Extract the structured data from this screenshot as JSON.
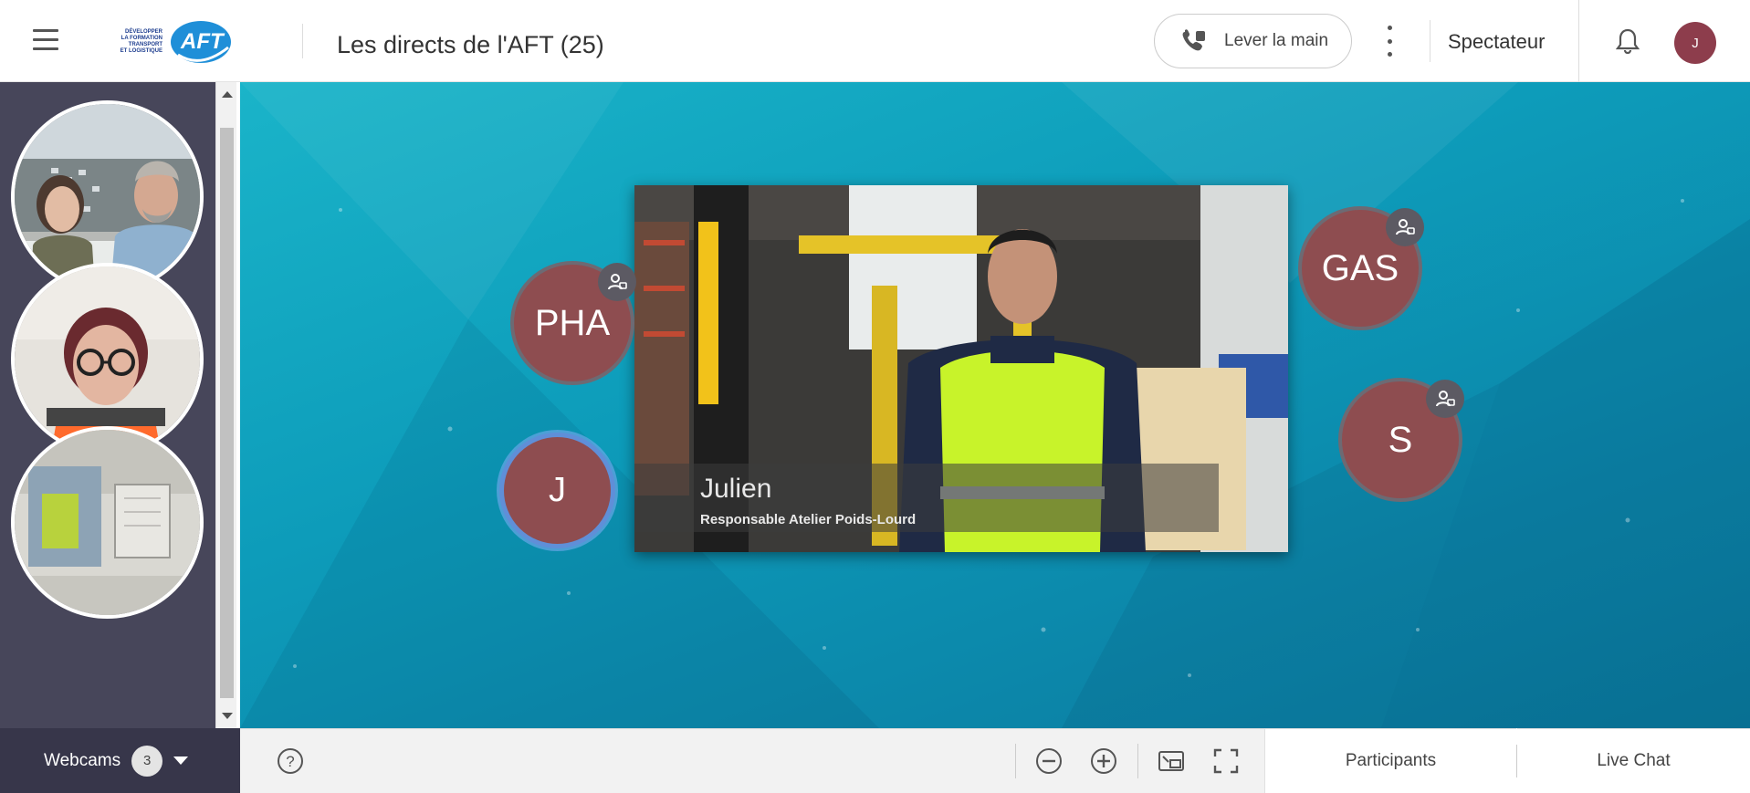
{
  "header": {
    "menu_icon": "hamburger-icon",
    "logo": {
      "lines": [
        "DÉVELOPPER",
        "LA FORMATION TRANSPORT",
        "ET LOGISTIQUE"
      ],
      "mark": "AFT",
      "colors": {
        "text": "#1d3d8f",
        "mark_bg": "#1f8fd8"
      }
    },
    "title": "Les directs de l'AFT (25)",
    "raise_hand_label": "Lever la main",
    "raise_hand_icon": "raise-hand-icon",
    "more_icon": "more-vertical-icon",
    "role_label": "Spectateur",
    "bell_icon": "bell-icon",
    "user_avatar_initial": "J",
    "avatar_color": "#8d3d4c"
  },
  "sidebar": {
    "webcams": [
      {
        "name": "webcam-1",
        "description_icon": "video-tile"
      },
      {
        "name": "webcam-2",
        "description_icon": "video-tile"
      },
      {
        "name": "webcam-3",
        "description_icon": "video-tile"
      }
    ]
  },
  "stage": {
    "video": {
      "caption_name": "Julien",
      "caption_role": "Responsable Atelier Poids-Lourd"
    },
    "participants": [
      {
        "initials": "PHA",
        "badge_icon": "presenter-icon"
      },
      {
        "initials": "J",
        "badge_icon": ""
      },
      {
        "initials": "GAS",
        "badge_icon": "presenter-icon"
      },
      {
        "initials": "S",
        "badge_icon": "presenter-icon"
      }
    ],
    "bubble_color": "#8e4d50",
    "background_color": "#109fbd"
  },
  "bottom": {
    "webcams_label": "Webcams",
    "webcams_count": "3",
    "help_icon": "help-icon",
    "zoom_out_icon": "zoom-out-icon",
    "zoom_in_icon": "zoom-in-icon",
    "pip_icon": "picture-in-picture-icon",
    "fullscreen_icon": "fullscreen-icon",
    "tabs": [
      "Participants",
      "Live Chat"
    ]
  }
}
